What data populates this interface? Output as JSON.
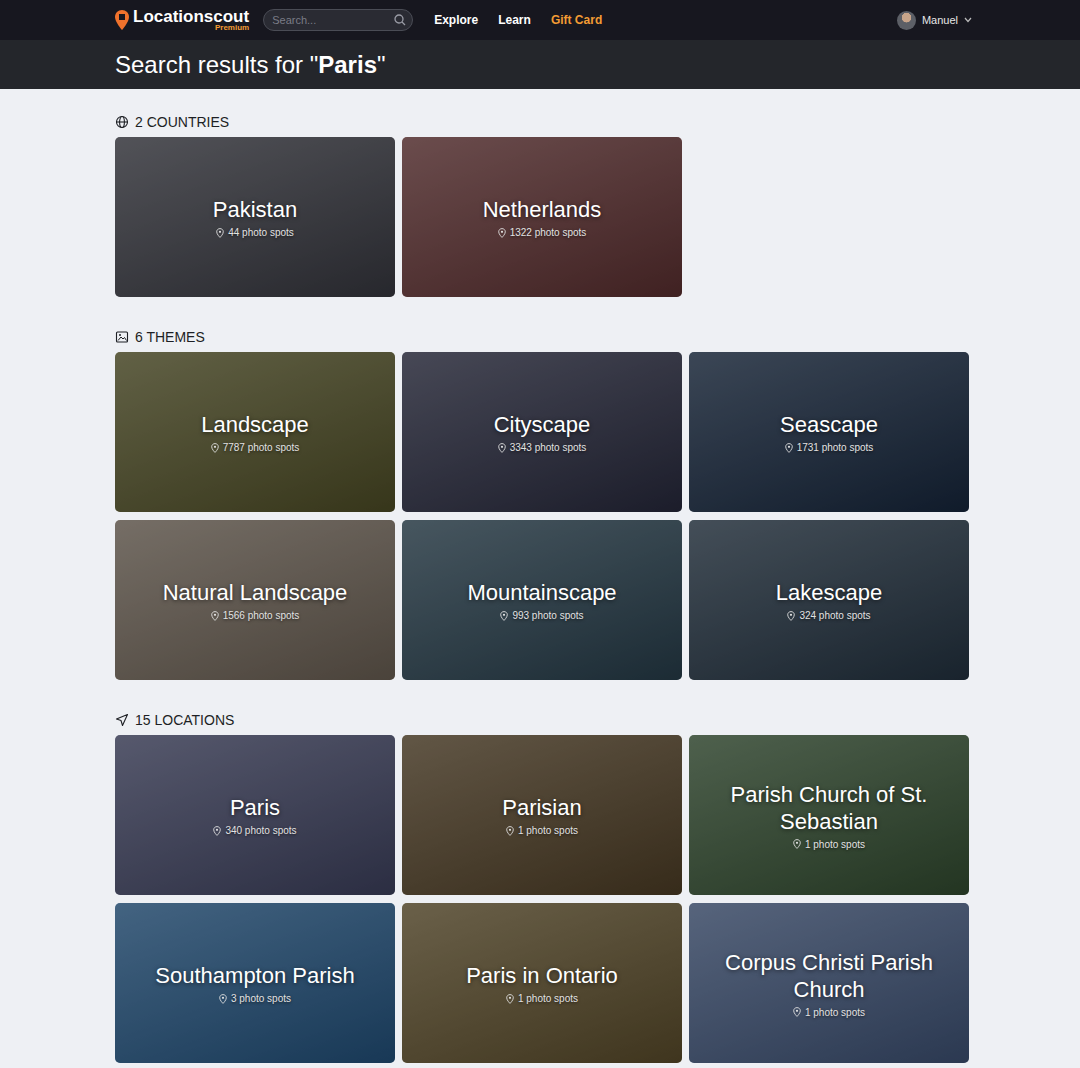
{
  "logo": {
    "name": "Locationscout",
    "tier": "Premium"
  },
  "search": {
    "placeholder": "Search..."
  },
  "nav": {
    "items": [
      {
        "label": "Explore",
        "color": "#ffffff"
      },
      {
        "label": "Learn",
        "color": "#ffffff"
      },
      {
        "label": "Gift Card",
        "color": "#f39c34"
      }
    ]
  },
  "user": {
    "name": "Manuel"
  },
  "heading": {
    "prefix": "Search results for \"",
    "query": "Paris",
    "suffix": "\""
  },
  "sections": [
    {
      "title": "2 COUNTRIES",
      "cards": [
        {
          "name": "Pakistan",
          "count": "44 photo spots",
          "color": "#55565a"
        },
        {
          "name": "Netherlands",
          "count": "1322 photo spots",
          "color": "#7d4c48"
        }
      ]
    },
    {
      "title": "6 THEMES",
      "cards": [
        {
          "name": "Landscape",
          "count": "7787 photo spots",
          "color": "#6e6d3c"
        },
        {
          "name": "Cityscape",
          "count": "3343 photo spots",
          "color": "#434556"
        },
        {
          "name": "Seascape",
          "count": "1731 photo spots",
          "color": "#304256"
        },
        {
          "name": "Natural Landscape",
          "count": "1566 photo spots",
          "color": "#8e8270"
        },
        {
          "name": "Mountainscape",
          "count": "993 photo spots",
          "color": "#435c66"
        },
        {
          "name": "Lakescape",
          "count": "324 photo spots",
          "color": "#3e4f5a"
        }
      ]
    },
    {
      "title": "15 LOCATIONS",
      "cards": [
        {
          "name": "Paris",
          "count": "340 photo spots",
          "color": "#5c607c"
        },
        {
          "name": "Parisian",
          "count": "1 photo spots",
          "color": "#6e5c3c"
        },
        {
          "name": "Parish Church of St. Sebastian",
          "count": "1 photo spots",
          "color": "#4f6c48"
        },
        {
          "name": "Southampton Parish",
          "count": "3 photo spots",
          "color": "#3d719c"
        },
        {
          "name": "Paris in Ontario",
          "count": "1 photo spots",
          "color": "#7c6c42"
        },
        {
          "name": "Corpus Christi Parish Church",
          "count": "1 photo spots",
          "color": "#5c7294"
        }
      ]
    }
  ]
}
